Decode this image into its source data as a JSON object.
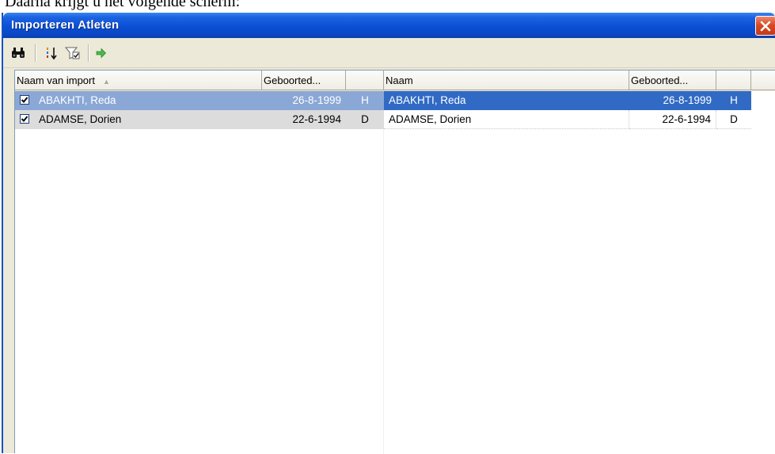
{
  "document": {
    "partial_text": "Daarna krijgt u het volgende scherm:"
  },
  "window": {
    "title": "Importeren Atleten"
  },
  "toolbar": {
    "buttons": [
      {
        "icon": "binoculars-icon"
      },
      {
        "icon": "sort-icon"
      },
      {
        "icon": "filter-icon"
      },
      {
        "icon": "arrow-right-icon"
      }
    ]
  },
  "grid": {
    "left_headers": [
      "Naam van import",
      "Geboorted...",
      ""
    ],
    "right_headers": [
      "Naam",
      "Geboorted...",
      ""
    ],
    "sort_indicator": "▲",
    "rows": [
      {
        "checked": true,
        "import_name": "ABAKHTI, Reda",
        "import_birth": "26-8-1999",
        "import_gender": "H",
        "name": "ABAKHTI, Reda",
        "birth": "26-8-1999",
        "gender": "H",
        "selected": true
      },
      {
        "checked": true,
        "import_name": "ADAMSE, Dorien",
        "import_birth": "22-6-1994",
        "import_gender": "D",
        "name": "ADAMSE, Dorien",
        "birth": "22-6-1994",
        "gender": "D",
        "selected": false
      }
    ]
  },
  "colors": {
    "titlebar": "#0a4fd6",
    "selection_right": "#316ac5",
    "selection_left": "#8aa7d6",
    "left_row_bg": "#dcdcdc"
  }
}
